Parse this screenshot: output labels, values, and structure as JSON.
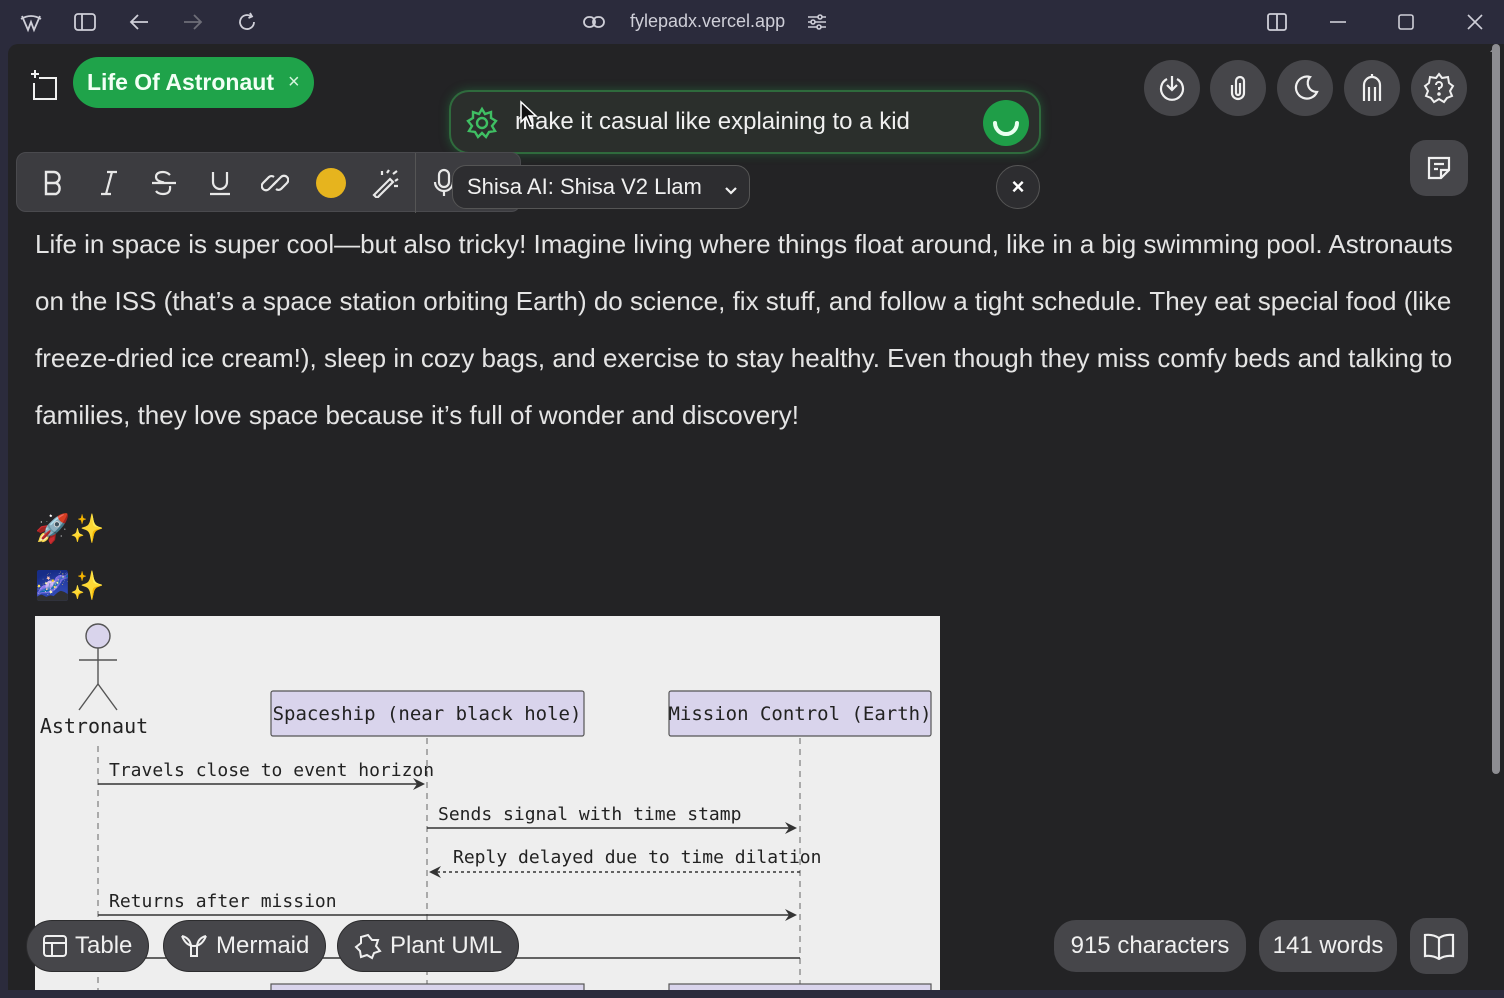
{
  "browser": {
    "url": "fylepadx.vercel.app",
    "icons": [
      "app-logo-icon",
      "sidebar-toggle-icon",
      "back-icon",
      "forward-icon",
      "reload-icon",
      "link-icon",
      "site-settings-icon",
      "split-view-icon",
      "minimize-icon",
      "maximize-icon",
      "close-icon"
    ]
  },
  "tab": {
    "title": "Life Of Astronaut",
    "close": "×"
  },
  "ai_prompt": {
    "text": "make it casual like explaining to a kid w",
    "model": "Shisa AI: Shisa V2 Llam",
    "close": "×"
  },
  "toolbar": {
    "highlight_color": "#e6b41e",
    "buttons": [
      "bold",
      "italic",
      "strikethrough",
      "underline",
      "link",
      "highlight-color",
      "magic-wand",
      "microphone"
    ]
  },
  "editor": {
    "paragraph": "Life in space is super cool—but also tricky! Imagine living where things float around, like in a big swimming pool. Astronauts on the ISS (that’s a space station orbiting Earth) do science, fix stuff, and follow a tight schedule. They eat special food (like freeze-dried ice cream!), sleep in cozy bags, and exercise to stay healthy. Even though they miss comfy beds and talking to families, they love space because it’s full of wonder and discovery!",
    "emoji_line_1": "🚀✨",
    "emoji_line_2": "🌌✨"
  },
  "diagram": {
    "actor": "Astronaut",
    "participant_1": "Spaceship (near black hole)",
    "participant_2": "Mission Control (Earth)",
    "msg_1": "Travels close to event horizon",
    "msg_2": "Sends signal with time stamp",
    "msg_3": "Reply delayed due to time dilation",
    "msg_4": "Returns after mission"
  },
  "bottom": {
    "table": "Table",
    "mermaid": "Mermaid",
    "plantuml": "Plant UML",
    "characters": "915 characters",
    "words": "141 words"
  }
}
